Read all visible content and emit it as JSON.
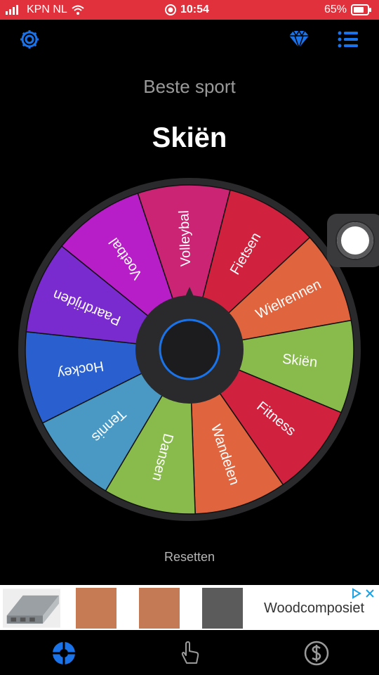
{
  "status": {
    "carrier": "KPN NL",
    "time": "10:54",
    "battery": "65%"
  },
  "header": {
    "settings_icon": "gear-icon",
    "premium_icon": "diamond-icon",
    "list_icon": "list-icon"
  },
  "wheel": {
    "title": "Beste sport",
    "result": "Skiën",
    "segments": [
      {
        "label": "Volleybal",
        "color": "#cc2474"
      },
      {
        "label": "Fietsen",
        "color": "#d0213e"
      },
      {
        "label": "Wielrennen",
        "color": "#e0643e"
      },
      {
        "label": "Skiën",
        "color": "#88bb4c"
      },
      {
        "label": "Fitness",
        "color": "#d0213e"
      },
      {
        "label": "Wandelen",
        "color": "#e0643e"
      },
      {
        "label": "Dansen",
        "color": "#88bb4c"
      },
      {
        "label": "Tennis",
        "color": "#4a98c4"
      },
      {
        "label": "Hockey",
        "color": "#2a5fcf"
      },
      {
        "label": "Paardrijden",
        "color": "#7a2bd0"
      },
      {
        "label": "Voetbal",
        "color": "#b81ec8"
      }
    ],
    "reset_label": "Resetten"
  },
  "ad": {
    "text": "Woodcomposiet",
    "swatch_colors": [
      "#c77b55",
      "#c47a55",
      "#5b5b5b"
    ]
  },
  "tabs": {
    "wheel_icon": "wheel-icon",
    "tap_icon": "hand-pointer-icon",
    "dollar_icon": "dollar-icon",
    "accent": "#1a73e8"
  }
}
